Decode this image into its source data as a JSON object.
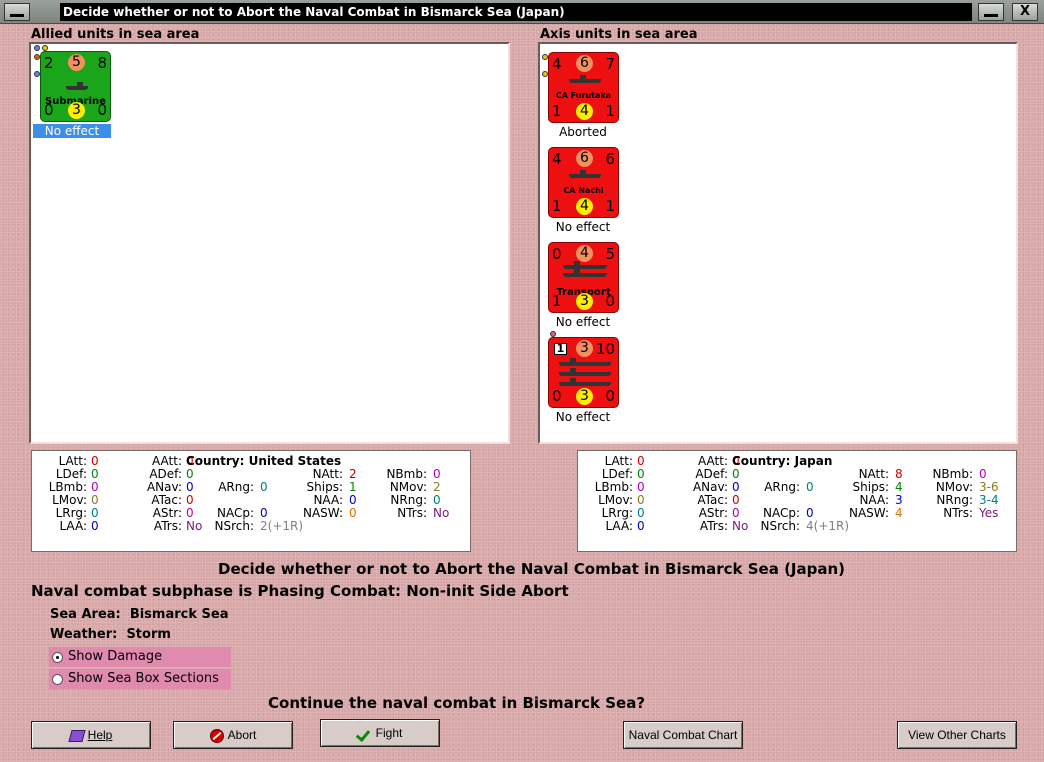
{
  "window": {
    "title": "Decide whether or not to Abort the Naval Combat in Bismarck Sea (Japan)",
    "close_glyph": "X"
  },
  "allied": {
    "label": "Allied units in sea area",
    "units": [
      {
        "tl": "2",
        "top": "5",
        "tr": "8",
        "name": "Submarine",
        "bl": "0",
        "bottom": "3",
        "br": "0",
        "status": "No effect",
        "color": "#1aa51a"
      }
    ]
  },
  "axis": {
    "label": "Axis units in sea area",
    "units": [
      {
        "tl": "4",
        "top": "6",
        "tr": "7",
        "name": "CA Furutaka",
        "bl": "1",
        "bottom": "4",
        "br": "1",
        "status": "Aborted",
        "color": "#ee1010"
      },
      {
        "tl": "4",
        "top": "6",
        "tr": "6",
        "name": "CA Nachi",
        "bl": "1",
        "bottom": "4",
        "br": "1",
        "status": "No effect",
        "color": "#ee1010"
      },
      {
        "tl": "0",
        "top": "4",
        "tr": "5",
        "name": "Transport",
        "bl": "1",
        "bottom": "3",
        "br": "0",
        "status": "No effect",
        "color": "#ee1010"
      },
      {
        "stack": "1",
        "top": "3",
        "tr": "10",
        "bl": "0",
        "bottom": "3",
        "br": "0",
        "status": "No effect",
        "color": "#ee1010"
      }
    ]
  },
  "stats_labels": {
    "latt": "LAtt:",
    "ldef": "LDef:",
    "lbmb": "LBmb:",
    "lmov": "LMov:",
    "lrrg": "LRrg:",
    "laa": "LAA:",
    "aatt": "AAtt:",
    "adef": "ADef:",
    "anav": "ANav:",
    "atac": "ATac:",
    "astr": "AStr:",
    "atrs": "ATrs:",
    "country": "Country:",
    "arng": "ARng:",
    "nacp": "NACp:",
    "nsrch": "NSrch:",
    "natt": "NAtt:",
    "ships": "Ships:",
    "naa": "NAA:",
    "nasw": "NASW:",
    "nbmb": "NBmb:",
    "nmov": "NMov:",
    "nrng": "NRng:",
    "ntrs": "NTrs:"
  },
  "allied_stats": {
    "latt": "0",
    "ldef": "0",
    "lbmb": "0",
    "lmov": "0",
    "lrrg": "0",
    "laa": "0",
    "aatt": "0",
    "adef": "0",
    "anav": "0",
    "atac": "0",
    "astr": "0",
    "atrs": "No",
    "country": "United States",
    "arng": "0",
    "nacp": "0",
    "nsrch": "2(+1R)",
    "natt": "2",
    "ships": "1",
    "naa": "0",
    "nasw": "0",
    "nbmb": "0",
    "nmov": "2",
    "nrng": "0",
    "ntrs": "No"
  },
  "axis_stats": {
    "latt": "0",
    "ldef": "0",
    "lbmb": "0",
    "lmov": "0",
    "lrrg": "0",
    "laa": "0",
    "aatt": "0",
    "adef": "0",
    "anav": "0",
    "atac": "0",
    "astr": "0",
    "atrs": "No",
    "country": "Japan",
    "arng": "0",
    "nacp": "0",
    "nsrch": "4(+1R)",
    "natt": "8",
    "ships": "4",
    "naa": "3",
    "nasw": "4",
    "nbmb": "0",
    "nmov": "3-6",
    "nrng": "3-4",
    "ntrs": "Yes"
  },
  "main": {
    "heading": "Decide whether or not to Abort the Naval Combat in Bismarck Sea (Japan)",
    "subphase": "Naval combat subphase is Phasing Combat: Non-init Side Abort",
    "sea_area_label": "Sea Area:",
    "sea_area": "Bismarck Sea",
    "weather_label": "Weather:",
    "weather": "Storm",
    "question": "Continue the naval combat in Bismarck Sea?"
  },
  "options": {
    "show_damage": "Show Damage",
    "show_sea_box": "Show Sea Box Sections"
  },
  "buttons": {
    "help": "Help",
    "abort": "Abort",
    "fight": "Fight",
    "naval_chart": "Naval Combat Chart",
    "other_charts": "View Other Charts"
  }
}
